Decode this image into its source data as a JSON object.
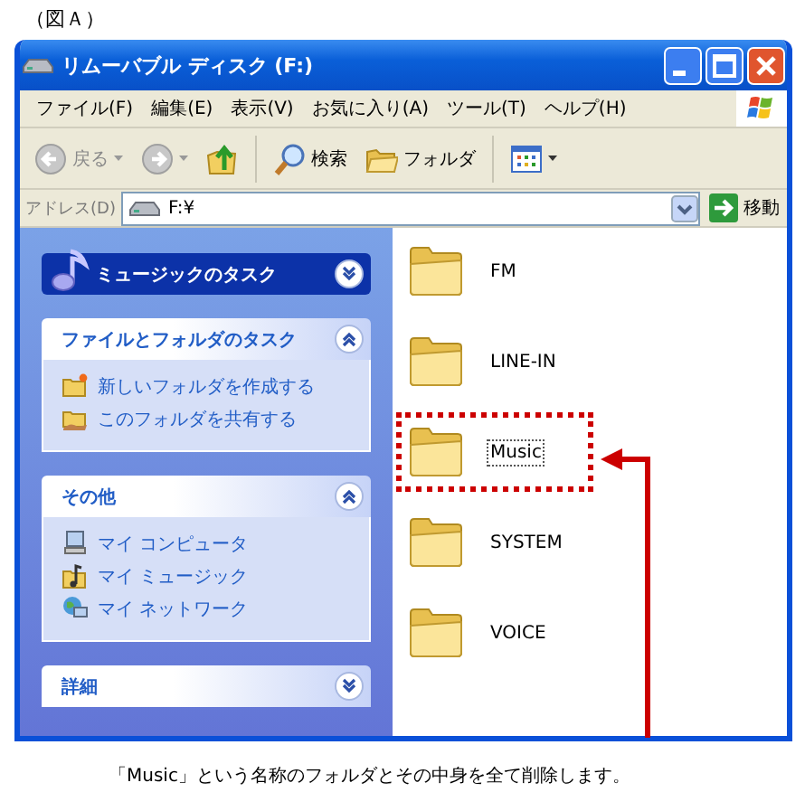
{
  "figure_label": "（図Ａ）",
  "window": {
    "title": "リムーバブル ディスク (F:)"
  },
  "menu": [
    "ファイル(F)",
    "編集(E)",
    "表示(V)",
    "お気に入り(A)",
    "ツール(T)",
    "ヘルプ(H)"
  ],
  "toolbar": [
    {
      "kind": "back",
      "label": "戻る",
      "disabled": true
    },
    {
      "kind": "forward",
      "disabled": true
    },
    {
      "kind": "up"
    },
    {
      "kind": "search",
      "label": "検索"
    },
    {
      "kind": "folders",
      "label": "フォルダ"
    },
    {
      "kind": "views"
    }
  ],
  "address": {
    "label": "アドレス(D)",
    "value": "F:¥",
    "go": "移動"
  },
  "panels": [
    {
      "kind": "special",
      "title": "ミュージックのタスク",
      "expanded": false
    },
    {
      "kind": "normal",
      "title": "ファイルとフォルダのタスク",
      "expanded": true,
      "items": [
        {
          "label": "新しいフォルダを作成する"
        },
        {
          "label": "このフォルダを共有する"
        }
      ]
    },
    {
      "kind": "normal",
      "title": "その他",
      "expanded": true,
      "items": [
        {
          "label": "マイ コンピュータ"
        },
        {
          "label": "マイ ミュージック"
        },
        {
          "label": "マイ ネットワーク"
        }
      ]
    },
    {
      "kind": "normal",
      "title": "詳細",
      "expanded": false
    }
  ],
  "folders": [
    {
      "name": "FM",
      "focused": false,
      "highlighted": false
    },
    {
      "name": "LINE-IN",
      "focused": false,
      "highlighted": false
    },
    {
      "name": "Music",
      "focused": true,
      "highlighted": true
    },
    {
      "name": "SYSTEM",
      "focused": false,
      "highlighted": false
    },
    {
      "name": "VOICE",
      "focused": false,
      "highlighted": false
    }
  ],
  "caption": "「Music」という名称のフォルダとその中身を全て削除します。"
}
